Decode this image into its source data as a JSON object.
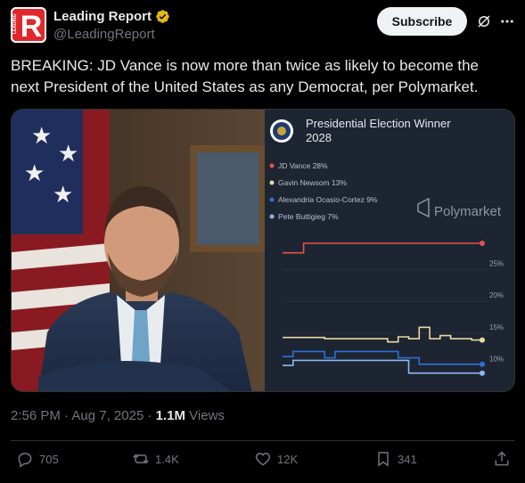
{
  "author": {
    "name": "Leading Report",
    "handle": "@LeadingReport",
    "logo_letter": "R",
    "logo_side_text": "LEADING"
  },
  "header": {
    "subscribe_label": "Subscribe"
  },
  "tweet": {
    "text": "BREAKING: JD Vance is now more than twice as likely to become the next President of the United States as any Democrat, per Polymarket.",
    "time": "2:56 PM",
    "date": "Aug 7, 2025",
    "views_count": "1.1M",
    "views_label": "Views",
    "sep": "·"
  },
  "chart_data": {
    "type": "line",
    "title": "Presidential Election Winner 2028",
    "brand": "Polymarket",
    "ylim": [
      0,
      30
    ],
    "yticks": [
      "25%",
      "20%",
      "15%",
      "10%"
    ],
    "ytick_values": [
      25,
      20,
      15,
      10
    ],
    "series": [
      {
        "name": "JD Vance 28%",
        "color": "#e5534b",
        "values": [
          26.5,
          26.5,
          28,
          28,
          28,
          28,
          28,
          28,
          28,
          28,
          28,
          28,
          28,
          28,
          28,
          28,
          28,
          28,
          28,
          28
        ]
      },
      {
        "name": "Gavin Newsom 13%",
        "color": "#e8d9a0",
        "values": [
          13.2,
          13.2,
          13.2,
          13.2,
          13.0,
          13.0,
          13.0,
          13.0,
          13.0,
          13.0,
          12.5,
          13.3,
          13.0,
          14.8,
          13.0,
          13.5,
          13.0,
          13.0,
          12.8,
          12.8
        ]
      },
      {
        "name": "Alexandria Ocasio-Cortez 9%",
        "color": "#2f6fd6",
        "values": [
          10.2,
          11.0,
          11.0,
          11.0,
          10.0,
          11.0,
          11.0,
          11.0,
          11.0,
          11.0,
          11.0,
          10.0,
          10.0,
          9.0,
          9.0,
          9.0,
          9.0,
          9.0,
          9.0,
          9.0
        ]
      },
      {
        "name": "Pete Buttigieg 7%",
        "color": "#8ab8f0",
        "values": [
          8.8,
          9.6,
          9.6,
          9.6,
          9.6,
          9.6,
          9.6,
          9.6,
          9.6,
          9.6,
          9.6,
          9.6,
          7.6,
          7.6,
          7.6,
          7.6,
          7.6,
          7.6,
          7.6,
          7.6
        ]
      }
    ]
  },
  "actions": {
    "replies": "705",
    "reposts": "1.4K",
    "likes": "12K",
    "bookmarks": "341"
  },
  "colors": {
    "background": "#000000",
    "text": "#e7e9ea",
    "muted": "#71767b",
    "verified_gold": "#e2b719",
    "logo_red": "#e0272c"
  }
}
